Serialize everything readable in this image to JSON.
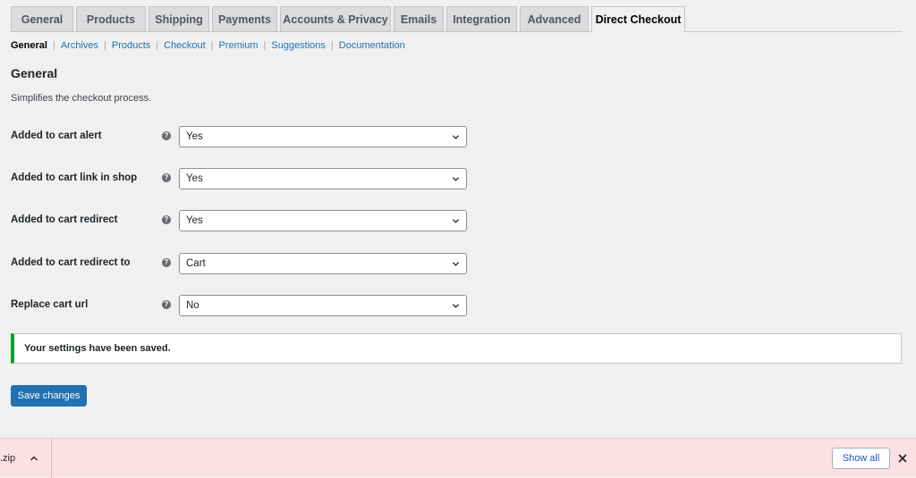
{
  "tabs": [
    {
      "label": "General"
    },
    {
      "label": "Products"
    },
    {
      "label": "Shipping"
    },
    {
      "label": "Payments"
    },
    {
      "label": "Accounts & Privacy"
    },
    {
      "label": "Emails"
    },
    {
      "label": "Integration"
    },
    {
      "label": "Advanced"
    },
    {
      "label": "Direct Checkout",
      "active": true
    }
  ],
  "subnav": [
    {
      "label": "General",
      "current": true
    },
    {
      "label": "Archives"
    },
    {
      "label": "Products"
    },
    {
      "label": "Checkout"
    },
    {
      "label": "Premium"
    },
    {
      "label": "Suggestions"
    },
    {
      "label": "Documentation"
    }
  ],
  "section": {
    "title": "General",
    "description": "Simplifies the checkout process."
  },
  "settings": [
    {
      "label": "Added to cart alert",
      "value": "Yes"
    },
    {
      "label": "Added to cart link in shop",
      "value": "Yes"
    },
    {
      "label": "Added to cart redirect",
      "value": "Yes"
    },
    {
      "label": "Added to cart redirect to",
      "value": "Cart"
    },
    {
      "label": "Replace cart url",
      "value": "No"
    }
  ],
  "help_glyph": "?",
  "notice": {
    "text": "Your settings have been saved.",
    "color": "#00a32a"
  },
  "save_button": {
    "label": "Save changes",
    "color": "#2271b1"
  },
  "download_bar": {
    "file_name": ".zip",
    "show_all_label": "Show all",
    "background": "#fde0e4"
  },
  "icons": {
    "help": "question-circle-icon",
    "select_arrow": "chevron-down-icon",
    "download_menu": "chevron-up-icon",
    "close": "close-icon"
  }
}
